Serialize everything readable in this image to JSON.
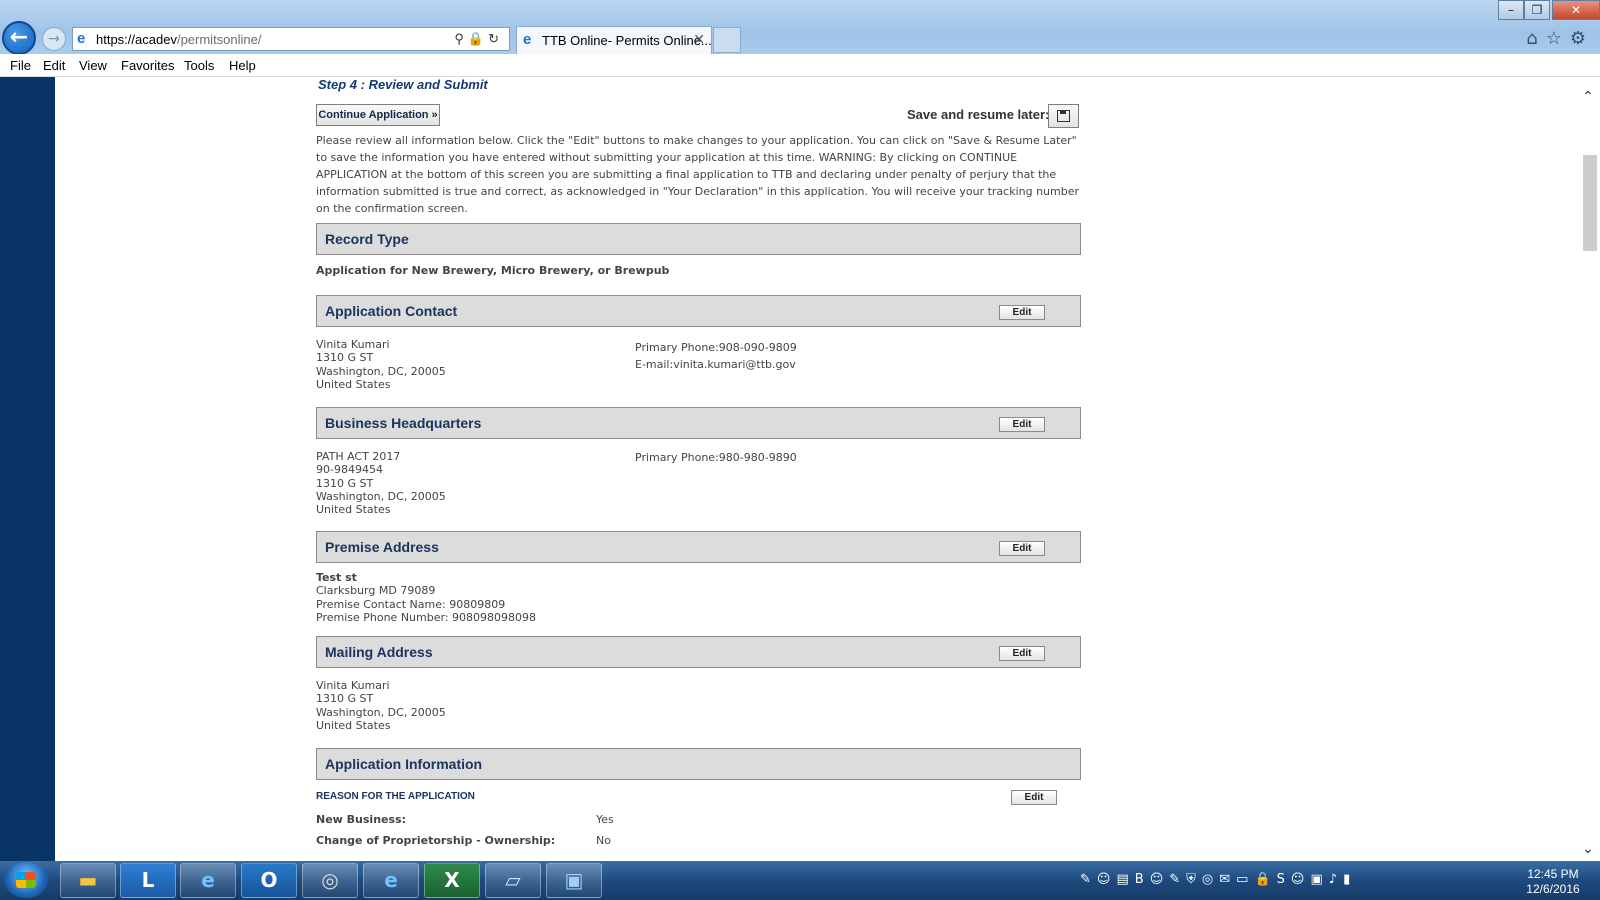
{
  "browser": {
    "url_host": "https://acadev",
    "url_path": "/permitsonline/",
    "tab_title": "TTB Online- Permits Online...",
    "menu": [
      "File",
      "Edit",
      "View",
      "Favorites",
      "Tools",
      "Help"
    ]
  },
  "page": {
    "step_title": "Step 4 : Review and Submit",
    "continue_button": "Continue Application »",
    "save_resume_label": "Save and resume later:",
    "instructions": "Please review all information below. Click the \"Edit\" buttons to make changes to your application. You can click on \"Save & Resume Later\" to save the information you have entered without submitting your application at this time. WARNING: By clicking on CONTINUE APPLICATION at the bottom of this screen you are submitting a final application to TTB and declaring under penalty of perjury that the information submitted is true and correct, as acknowledged in \"Your Declaration\" in this application. You will receive your tracking number on the confirmation screen.",
    "edit_label": "Edit",
    "record_type": {
      "title": "Record Type",
      "value": "Application for New Brewery, Micro Brewery, or Brewpub"
    },
    "application_contact": {
      "title": "Application Contact",
      "lines": [
        "Vinita Kumari",
        "1310 G ST",
        "Washington, DC, 20005",
        "United States"
      ],
      "phone": "Primary Phone:908-090-9809",
      "email": "E-mail:vinita.kumari@ttb.gov"
    },
    "business_headquarters": {
      "title": "Business Headquarters",
      "lines": [
        "PATH ACT 2017",
        "90-9849454",
        "1310 G ST",
        "Washington, DC, 20005",
        "United States"
      ],
      "phone": "Primary Phone:980-980-9890"
    },
    "premise_address": {
      "title": "Premise Address",
      "street": "Test st",
      "lines": [
        "Clarksburg MD 79089",
        "Premise Contact Name: 90809809",
        "Premise Phone Number: 908098098098"
      ]
    },
    "mailing_address": {
      "title": "Mailing Address",
      "lines": [
        "Vinita Kumari",
        "1310 G ST",
        "Washington, DC, 20005",
        "United States"
      ]
    },
    "application_information": {
      "title": "Application Information",
      "reason_heading": "REASON FOR THE APPLICATION",
      "rows": [
        {
          "label": "New Business:",
          "value": "Yes"
        },
        {
          "label": "Change of Proprietorship - Ownership:",
          "value": "No"
        }
      ]
    }
  },
  "taskbar": {
    "apps": [
      "file-explorer",
      "lync",
      "internet-explorer",
      "outlook",
      "chrome-like",
      "internet-explorer-2",
      "excel",
      "notepad",
      "image-viewer"
    ],
    "time": "12:45 PM",
    "date": "12/6/2016"
  }
}
